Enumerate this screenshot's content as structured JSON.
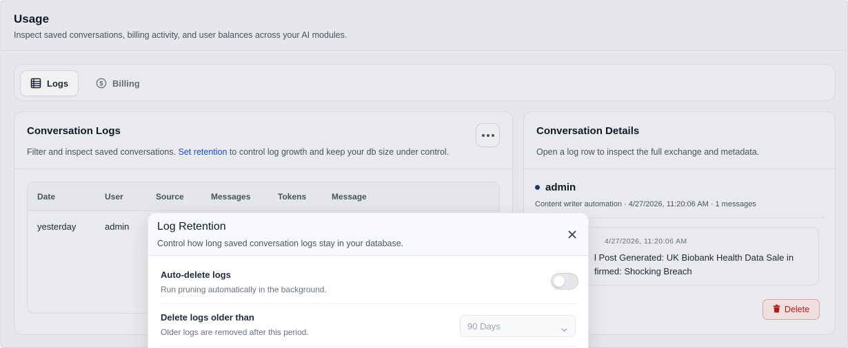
{
  "page": {
    "title": "Usage",
    "subtitle": "Inspect saved conversations, billing activity, and user balances across your AI modules."
  },
  "tabs": [
    {
      "label": "Logs",
      "icon": "table-icon",
      "active": true
    },
    {
      "label": "Billing",
      "icon": "dollar-circle-icon",
      "active": false
    }
  ],
  "logs_card": {
    "title": "Conversation Logs",
    "desc_before": "Filter and inspect saved conversations. ",
    "desc_link": "Set retention",
    "desc_after": " to control log growth and keep your db size under control.",
    "more_icon": "more-horizontal-icon",
    "columns": [
      "Date",
      "User",
      "Source",
      "Messages",
      "Tokens",
      "Message"
    ],
    "rows": [
      {
        "date": "yesterday",
        "user": "admin"
      }
    ]
  },
  "details_card": {
    "title": "Conversation Details",
    "desc": "Open a log row to inspect the full exchange and metadata.",
    "user": "admin",
    "meta": "Content writer automation · 4/27/2026, 11:20:06 AM · 1 messages",
    "message_meta": "4/27/2026, 11:20:06 AM",
    "message_line1": "l Post Generated: UK Biobank Health Data Sale in",
    "message_line2": "firmed: Shocking Breach",
    "delete_label": "Delete",
    "delete_icon": "trash-icon"
  },
  "modal": {
    "title": "Log Retention",
    "subtitle": "Control how long saved conversation logs stay in your database.",
    "close_icon": "close-icon",
    "auto_delete": {
      "label": "Auto-delete logs",
      "help": "Run pruning automatically in the background.",
      "enabled": false
    },
    "older_than": {
      "label": "Delete logs older than",
      "help": "Older logs are removed after this period.",
      "value": "90 Days"
    }
  },
  "colors": {
    "link": "#1d4ed8",
    "danger": "#b91c1c",
    "danger_bg": "#fdecec"
  }
}
